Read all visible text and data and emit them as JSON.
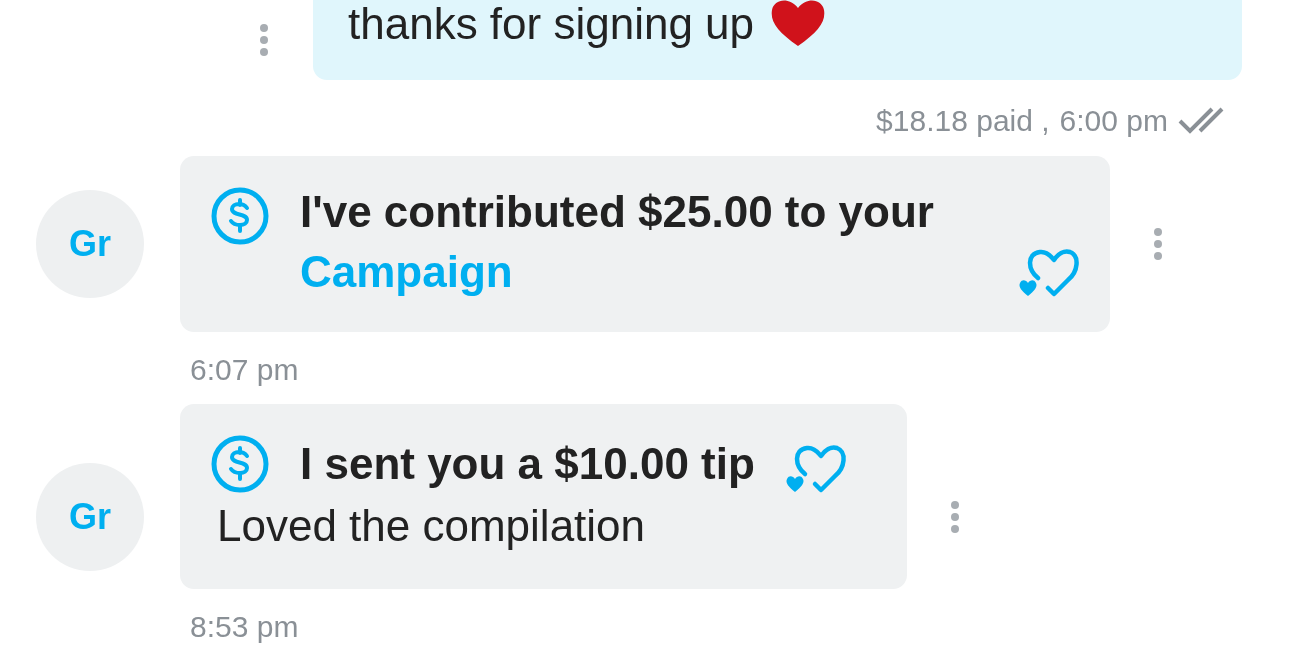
{
  "sent_message": {
    "text": "thanks for signing up",
    "price": "$18.18 paid ,",
    "time": "6:00 pm",
    "read": true
  },
  "messages": [
    {
      "kind": "campaign",
      "avatar": "Gr",
      "text": "I've contributed $25.00 to your",
      "link": "Campaign",
      "time": "6:07 pm"
    },
    {
      "kind": "tip",
      "avatar": "Gr",
      "text": "I sent you a $10.00 tip",
      "note": "Loved the compilation",
      "time": "8:53 pm"
    }
  ]
}
